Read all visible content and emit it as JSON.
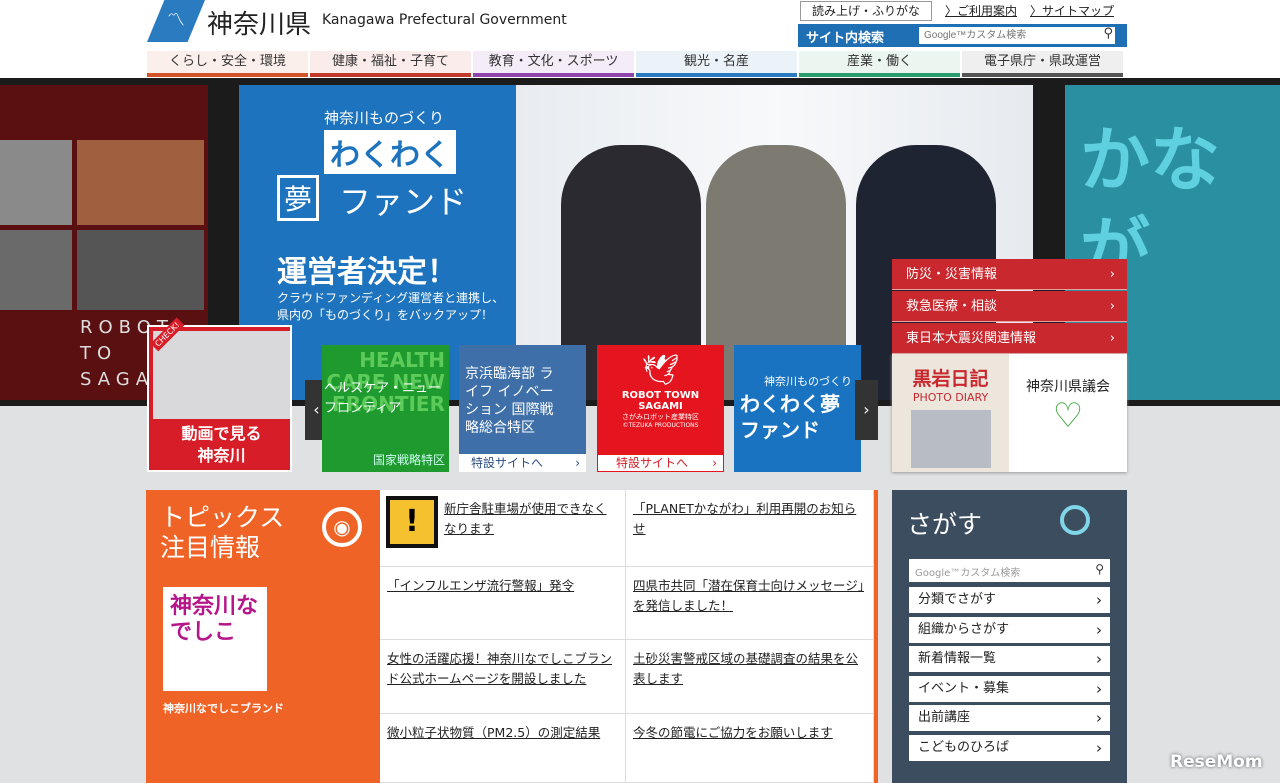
{
  "header": {
    "logo_jp": "神奈川県",
    "logo_en": "Kanagawa Prefectural Government",
    "read_aloud": "読み上げ・ふりがな",
    "guide": "ご利用案内",
    "sitemap": "サイトマップ",
    "search_label": "サイト内検索",
    "search_placeholder": "Google™カスタム検索"
  },
  "nav": [
    {
      "label": "くらし・安全・環境",
      "color": "#d2522a"
    },
    {
      "label": "健康・福祉・子育て",
      "color": "#c0392b"
    },
    {
      "label": "教育・文化・スポーツ",
      "color": "#8e44ad"
    },
    {
      "label": "観光・名産",
      "color": "#2a7bbf"
    },
    {
      "label": "産業・働く",
      "color": "#2a9d6e"
    },
    {
      "label": "電子県庁・県政運営",
      "color": "#555555"
    }
  ],
  "hero": {
    "kicker": "神奈川ものづくり",
    "title1": "わくわく",
    "title2": "夢",
    "title3": "ファンド",
    "headline": "運営者決定！",
    "sub": "クラウドファンディング運営者と連携し、県内の「ものづくり」をバックアップ！",
    "left_text": "ROBOT TO SAGAMI",
    "right_text": "かなが"
  },
  "red_menu": [
    "防災・災害情報",
    "救急医療・相談",
    "東日本大震災関連情報"
  ],
  "diary": {
    "title": "黒岩日記",
    "sub": "PHOTO DIARY",
    "assembly": "神奈川県議会"
  },
  "check": {
    "badge": "CHECK!",
    "label": "動画で見る神奈川"
  },
  "thumbs": [
    {
      "en": "HEALTH CARE NEW FRONTIER",
      "jp": "ヘルスケア・ニューフロンティア",
      "foot": "国家戦略特区"
    },
    {
      "jp": "京浜臨海部 ライフ イノベーション 国際戦略総合特区",
      "foot": "特設サイトへ"
    },
    {
      "en": "ROBOT TOWN SAGAMI",
      "jp": "さがみロボット産業特区",
      "credit": "©TEZUKA PRODUCTIONS",
      "foot": "特設サイトへ"
    },
    {
      "jp": "神奈川ものづくり",
      "title": "わくわく夢ファンド"
    }
  ],
  "topics": {
    "title1": "トピックス",
    "title2": "注目情報",
    "brand": "神奈川なでしこブランド",
    "items": [
      "新庁舎駐車場が使用できなくなります",
      "「PLANETかながわ」利用再開のお知らせ",
      "「インフルエンザ流行警報」発令",
      "四県市共同「潜在保育士向けメッセージ」を発信しました！",
      "女性の活躍応援！神奈川なでしこブランド公式ホームページを開設しました",
      "土砂災害警戒区域の基礎調査の結果を公表します",
      "微小粒子状物質（PM2.5）の測定結果",
      "今冬の節電にご協力をお願いします"
    ]
  },
  "sagasu": {
    "title": "さがす",
    "placeholder": "Google™カスタム検索",
    "items": [
      "分類でさがす",
      "組織からさがす",
      "新着情報一覧",
      "イベント・募集",
      "出前講座",
      "こどものひろば"
    ]
  },
  "watermark": "ReseMom"
}
